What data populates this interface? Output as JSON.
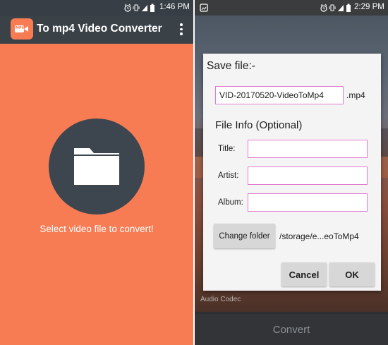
{
  "left_screen": {
    "status_bar": {
      "time": "1:46 PM",
      "icons": [
        "alarm-icon",
        "vibrate-icon",
        "signal-icon",
        "battery-icon"
      ]
    },
    "app_bar": {
      "icon": "video-convert-app-icon",
      "icon_badge": "MP4",
      "title": "To mp4 Video Converter",
      "menu_icon": "overflow-menu-icon"
    },
    "main": {
      "folder_icon": "folder-icon",
      "prompt": "Select video file to convert!"
    },
    "colors": {
      "background": "#f77c54",
      "app_bar": "#3a4147",
      "circle": "#3d464e"
    }
  },
  "right_screen": {
    "status_bar": {
      "time": "2:29 PM",
      "icons": [
        "gallery-notification-icon",
        "alarm-icon",
        "vibrate-icon",
        "signal-icon",
        "battery-icon"
      ]
    },
    "dialog": {
      "title": "Save file:-",
      "filename_value": "VID-20170520-VideoToMp4",
      "extension": ".mp4",
      "info_heading": "File Info (Optional)",
      "fields": [
        {
          "label": "Title:",
          "value": ""
        },
        {
          "label": "Artist:",
          "value": ""
        },
        {
          "label": "Album:",
          "value": ""
        }
      ],
      "change_folder_label": "Change folder",
      "folder_path": "/storage/e...eoToMp4",
      "cancel_label": "Cancel",
      "ok_label": "OK"
    },
    "background": {
      "audio_codec_label": "Audio Codec",
      "convert_label": "Convert"
    },
    "colors": {
      "input_border": "#e27bd0",
      "dialog_bg": "#f4f4f4",
      "button_bg": "#d7d7d7"
    }
  }
}
